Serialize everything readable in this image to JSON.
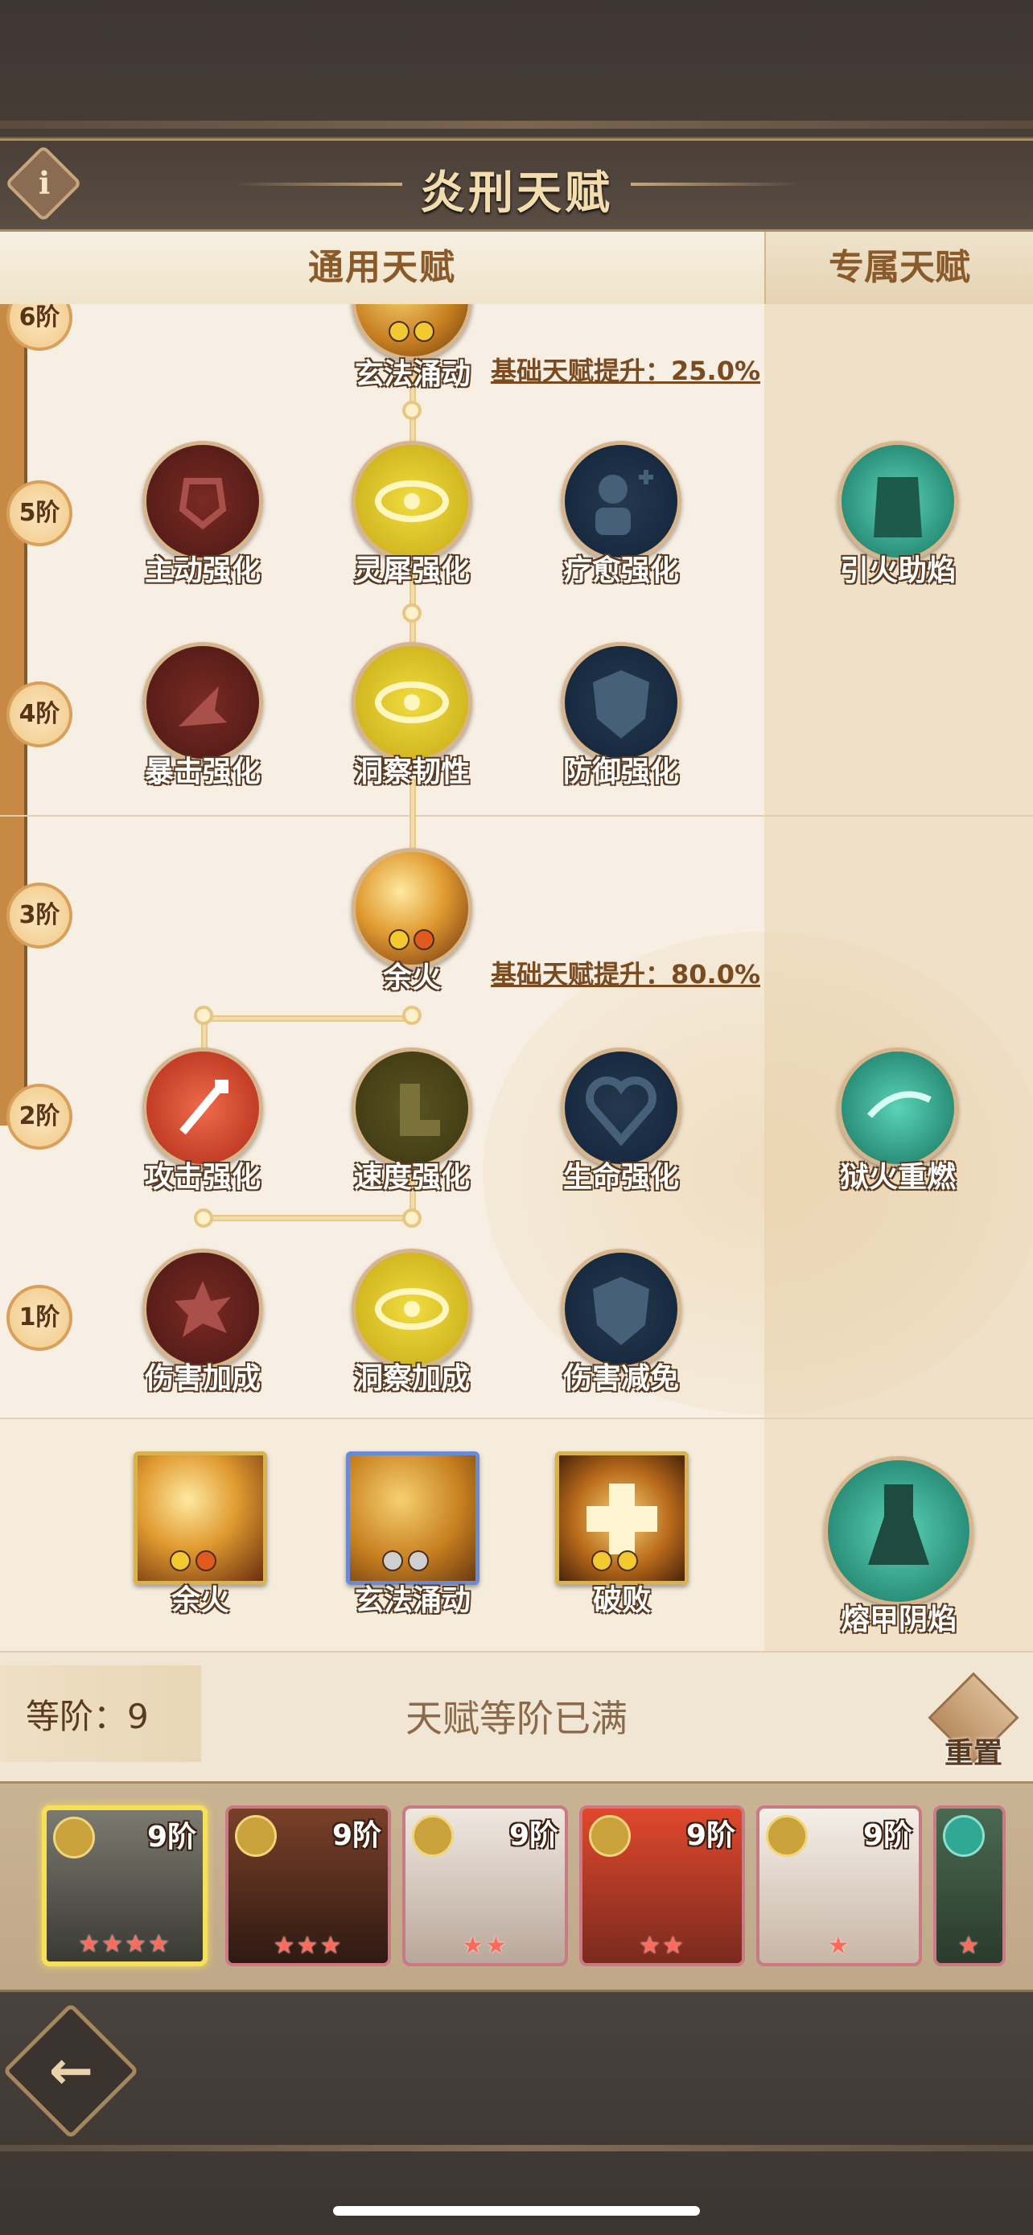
{
  "header": {
    "title": "炎刑天赋",
    "info_icon": "i"
  },
  "tabs": {
    "general": "通用天赋",
    "exclusive": "专属天赋"
  },
  "tree": {
    "tiers": [
      "6阶",
      "5阶",
      "4阶",
      "3阶",
      "2阶",
      "1阶"
    ],
    "tier6": {
      "node": "玄法涌动",
      "boost": "基础天赋提升：25.0%"
    },
    "tier5": [
      "主动强化",
      "灵犀强化",
      "疗愈强化"
    ],
    "tier5_exclusive": "引火助焰",
    "tier4": [
      "暴击强化",
      "洞察韧性",
      "防御强化"
    ],
    "tier3": {
      "node": "余火",
      "boost": "基础天赋提升：80.0%"
    },
    "tier2": [
      "攻击强化",
      "速度强化",
      "生命强化"
    ],
    "tier2_exclusive": "狱火重燃",
    "tier1": [
      "伤害加成",
      "洞察加成",
      "伤害减免"
    ]
  },
  "equipped": {
    "slots": [
      "余火",
      "玄法涌动",
      "破败"
    ],
    "exclusive": "熔甲阴焰"
  },
  "status": {
    "grade_label": "等阶：9",
    "message": "天赋等阶已满",
    "reset_label": "重置"
  },
  "heroes": [
    {
      "level": "9阶",
      "stars": "★★★★"
    },
    {
      "level": "9阶",
      "stars": "★★★"
    },
    {
      "level": "9阶",
      "stars": "★★"
    },
    {
      "level": "9阶",
      "stars": "★★"
    },
    {
      "level": "9阶",
      "stars": "★"
    },
    {
      "level": "",
      "stars": "★"
    }
  ],
  "back_icon": "back-arrow-icon"
}
